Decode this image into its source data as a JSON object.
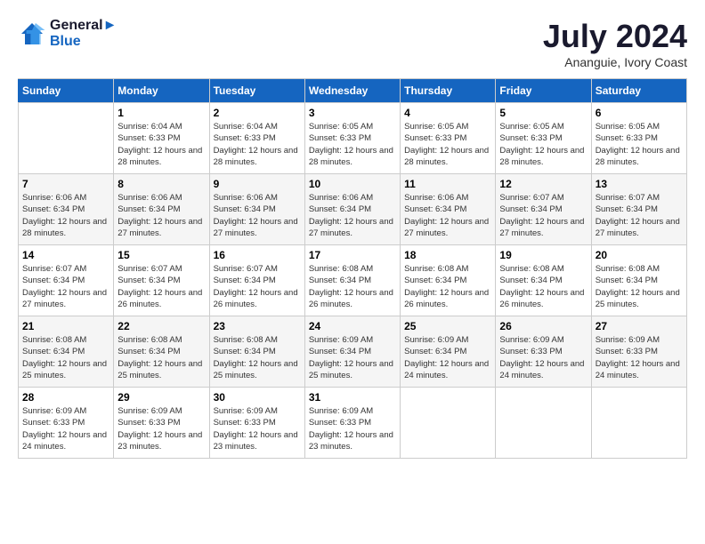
{
  "header": {
    "logo_line1": "General",
    "logo_line2": "Blue",
    "month": "July 2024",
    "location": "Ananguie, Ivory Coast"
  },
  "weekdays": [
    "Sunday",
    "Monday",
    "Tuesday",
    "Wednesday",
    "Thursday",
    "Friday",
    "Saturday"
  ],
  "weeks": [
    [
      {
        "day": "",
        "sunrise": "",
        "sunset": "",
        "daylight": ""
      },
      {
        "day": "1",
        "sunrise": "Sunrise: 6:04 AM",
        "sunset": "Sunset: 6:33 PM",
        "daylight": "Daylight: 12 hours and 28 minutes."
      },
      {
        "day": "2",
        "sunrise": "Sunrise: 6:04 AM",
        "sunset": "Sunset: 6:33 PM",
        "daylight": "Daylight: 12 hours and 28 minutes."
      },
      {
        "day": "3",
        "sunrise": "Sunrise: 6:05 AM",
        "sunset": "Sunset: 6:33 PM",
        "daylight": "Daylight: 12 hours and 28 minutes."
      },
      {
        "day": "4",
        "sunrise": "Sunrise: 6:05 AM",
        "sunset": "Sunset: 6:33 PM",
        "daylight": "Daylight: 12 hours and 28 minutes."
      },
      {
        "day": "5",
        "sunrise": "Sunrise: 6:05 AM",
        "sunset": "Sunset: 6:33 PM",
        "daylight": "Daylight: 12 hours and 28 minutes."
      },
      {
        "day": "6",
        "sunrise": "Sunrise: 6:05 AM",
        "sunset": "Sunset: 6:33 PM",
        "daylight": "Daylight: 12 hours and 28 minutes."
      }
    ],
    [
      {
        "day": "7",
        "sunrise": "Sunrise: 6:06 AM",
        "sunset": "Sunset: 6:34 PM",
        "daylight": "Daylight: 12 hours and 28 minutes."
      },
      {
        "day": "8",
        "sunrise": "Sunrise: 6:06 AM",
        "sunset": "Sunset: 6:34 PM",
        "daylight": "Daylight: 12 hours and 27 minutes."
      },
      {
        "day": "9",
        "sunrise": "Sunrise: 6:06 AM",
        "sunset": "Sunset: 6:34 PM",
        "daylight": "Daylight: 12 hours and 27 minutes."
      },
      {
        "day": "10",
        "sunrise": "Sunrise: 6:06 AM",
        "sunset": "Sunset: 6:34 PM",
        "daylight": "Daylight: 12 hours and 27 minutes."
      },
      {
        "day": "11",
        "sunrise": "Sunrise: 6:06 AM",
        "sunset": "Sunset: 6:34 PM",
        "daylight": "Daylight: 12 hours and 27 minutes."
      },
      {
        "day": "12",
        "sunrise": "Sunrise: 6:07 AM",
        "sunset": "Sunset: 6:34 PM",
        "daylight": "Daylight: 12 hours and 27 minutes."
      },
      {
        "day": "13",
        "sunrise": "Sunrise: 6:07 AM",
        "sunset": "Sunset: 6:34 PM",
        "daylight": "Daylight: 12 hours and 27 minutes."
      }
    ],
    [
      {
        "day": "14",
        "sunrise": "Sunrise: 6:07 AM",
        "sunset": "Sunset: 6:34 PM",
        "daylight": "Daylight: 12 hours and 27 minutes."
      },
      {
        "day": "15",
        "sunrise": "Sunrise: 6:07 AM",
        "sunset": "Sunset: 6:34 PM",
        "daylight": "Daylight: 12 hours and 26 minutes."
      },
      {
        "day": "16",
        "sunrise": "Sunrise: 6:07 AM",
        "sunset": "Sunset: 6:34 PM",
        "daylight": "Daylight: 12 hours and 26 minutes."
      },
      {
        "day": "17",
        "sunrise": "Sunrise: 6:08 AM",
        "sunset": "Sunset: 6:34 PM",
        "daylight": "Daylight: 12 hours and 26 minutes."
      },
      {
        "day": "18",
        "sunrise": "Sunrise: 6:08 AM",
        "sunset": "Sunset: 6:34 PM",
        "daylight": "Daylight: 12 hours and 26 minutes."
      },
      {
        "day": "19",
        "sunrise": "Sunrise: 6:08 AM",
        "sunset": "Sunset: 6:34 PM",
        "daylight": "Daylight: 12 hours and 26 minutes."
      },
      {
        "day": "20",
        "sunrise": "Sunrise: 6:08 AM",
        "sunset": "Sunset: 6:34 PM",
        "daylight": "Daylight: 12 hours and 25 minutes."
      }
    ],
    [
      {
        "day": "21",
        "sunrise": "Sunrise: 6:08 AM",
        "sunset": "Sunset: 6:34 PM",
        "daylight": "Daylight: 12 hours and 25 minutes."
      },
      {
        "day": "22",
        "sunrise": "Sunrise: 6:08 AM",
        "sunset": "Sunset: 6:34 PM",
        "daylight": "Daylight: 12 hours and 25 minutes."
      },
      {
        "day": "23",
        "sunrise": "Sunrise: 6:08 AM",
        "sunset": "Sunset: 6:34 PM",
        "daylight": "Daylight: 12 hours and 25 minutes."
      },
      {
        "day": "24",
        "sunrise": "Sunrise: 6:09 AM",
        "sunset": "Sunset: 6:34 PM",
        "daylight": "Daylight: 12 hours and 25 minutes."
      },
      {
        "day": "25",
        "sunrise": "Sunrise: 6:09 AM",
        "sunset": "Sunset: 6:34 PM",
        "daylight": "Daylight: 12 hours and 24 minutes."
      },
      {
        "day": "26",
        "sunrise": "Sunrise: 6:09 AM",
        "sunset": "Sunset: 6:33 PM",
        "daylight": "Daylight: 12 hours and 24 minutes."
      },
      {
        "day": "27",
        "sunrise": "Sunrise: 6:09 AM",
        "sunset": "Sunset: 6:33 PM",
        "daylight": "Daylight: 12 hours and 24 minutes."
      }
    ],
    [
      {
        "day": "28",
        "sunrise": "Sunrise: 6:09 AM",
        "sunset": "Sunset: 6:33 PM",
        "daylight": "Daylight: 12 hours and 24 minutes."
      },
      {
        "day": "29",
        "sunrise": "Sunrise: 6:09 AM",
        "sunset": "Sunset: 6:33 PM",
        "daylight": "Daylight: 12 hours and 23 minutes."
      },
      {
        "day": "30",
        "sunrise": "Sunrise: 6:09 AM",
        "sunset": "Sunset: 6:33 PM",
        "daylight": "Daylight: 12 hours and 23 minutes."
      },
      {
        "day": "31",
        "sunrise": "Sunrise: 6:09 AM",
        "sunset": "Sunset: 6:33 PM",
        "daylight": "Daylight: 12 hours and 23 minutes."
      },
      {
        "day": "",
        "sunrise": "",
        "sunset": "",
        "daylight": ""
      },
      {
        "day": "",
        "sunrise": "",
        "sunset": "",
        "daylight": ""
      },
      {
        "day": "",
        "sunrise": "",
        "sunset": "",
        "daylight": ""
      }
    ]
  ]
}
